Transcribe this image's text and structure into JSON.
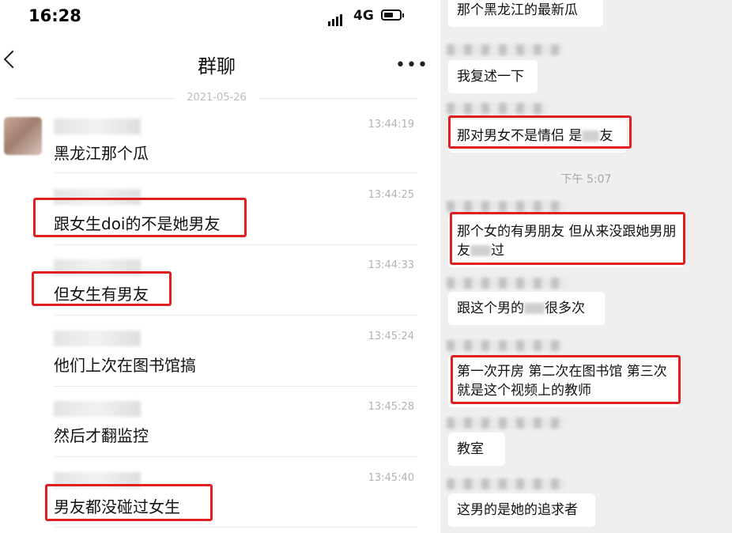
{
  "status_bar": {
    "time": "16:28",
    "network": "4G",
    "battery_level_fraction": 0.6
  },
  "header": {
    "title": "群聊"
  },
  "date_divider": "2021-05-26",
  "left_messages": [
    {
      "time": "13:44:19",
      "text": "黑龙江那个瓜",
      "highlighted": false
    },
    {
      "time": "13:44:25",
      "text": "跟女生doi的不是她男友",
      "highlighted": true
    },
    {
      "time": "13:44:33",
      "text": "但女生有男友",
      "highlighted": true
    },
    {
      "time": "13:45:24",
      "text": "他们上次在图书馆搞",
      "highlighted": false
    },
    {
      "time": "13:45:28",
      "text": "然后才翻监控",
      "highlighted": false
    },
    {
      "time": "13:45:40",
      "text": "男友都没碰过女生",
      "highlighted": true
    }
  ],
  "right_chat": {
    "time_divider": "下午 5:07",
    "messages": [
      {
        "text": "那个黑龙江的最新瓜",
        "highlighted": false
      },
      {
        "text": "我复述一下",
        "highlighted": false
      },
      {
        "text": "那对男女不是情侣 是",
        "text_suffix": "友",
        "highlighted": true
      },
      {
        "text": "那个女的有男朋友 但从来没跟她男朋友",
        "text_suffix": "过",
        "highlighted": true
      },
      {
        "text": "跟这个男的",
        "text_suffix": "很多次",
        "highlighted": false
      },
      {
        "text": "第一次开房 第二次在图书馆 第三次就是这个视频上的教师",
        "highlighted": true
      },
      {
        "text": "教室",
        "highlighted": false
      },
      {
        "text": "这男的是她的追求者",
        "highlighted": false
      }
    ]
  },
  "colors": {
    "highlight": "#e02020",
    "right_background": "#efefef",
    "bubble": "#ffffff"
  }
}
